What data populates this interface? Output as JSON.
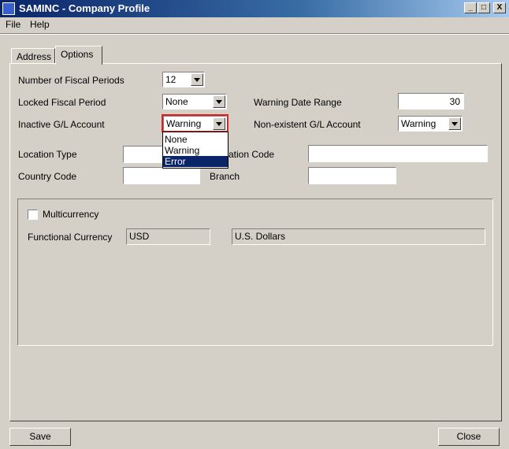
{
  "window": {
    "title": "SAMINC - Company Profile",
    "minimize": "_",
    "maximize": "□",
    "close": "X"
  },
  "menu": {
    "file": "File",
    "help": "Help"
  },
  "tabs": {
    "address": "Address",
    "options": "Options"
  },
  "fields": {
    "fiscal_periods": {
      "label": "Number of Fiscal Periods",
      "value": "12"
    },
    "locked_period": {
      "label": "Locked Fiscal Period",
      "value": "None"
    },
    "warning_date_range": {
      "label": "Warning Date Range",
      "value": "30"
    },
    "inactive_gl": {
      "label": "Inactive G/L Account",
      "value": "Warning"
    },
    "nonexistent_gl": {
      "label": "Non-existent G/L Account",
      "value": "Warning"
    },
    "location_type": {
      "label": "Location Type",
      "value": ""
    },
    "location_code": {
      "label": "ation Code",
      "value": ""
    },
    "country_code": {
      "label": "Country Code",
      "value": ""
    },
    "branch": {
      "label": "Branch",
      "value": ""
    }
  },
  "dropdown": {
    "options": [
      "None",
      "Warning",
      "Error"
    ],
    "selected_index": 2
  },
  "currency": {
    "multicurrency_label": "Multicurrency",
    "multicurrency_checked": false,
    "functional_label": "Functional Currency",
    "code": "USD",
    "description": "U.S. Dollars"
  },
  "buttons": {
    "save": "Save",
    "close": "Close"
  }
}
